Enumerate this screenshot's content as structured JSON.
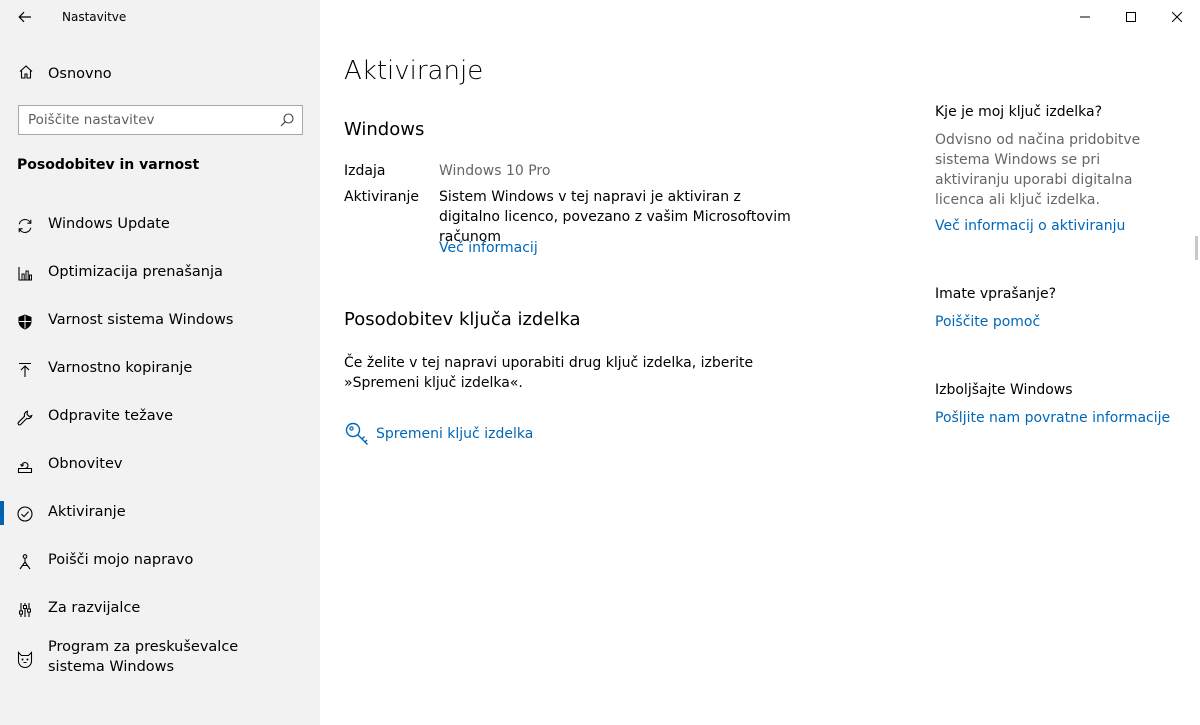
{
  "window": {
    "title": "Nastavitve"
  },
  "sidebar": {
    "home_label": "Osnovno",
    "search_placeholder": "Poiščite nastavitev",
    "section_title": "Posodobitev in varnost",
    "items": [
      {
        "label": "Windows Update",
        "icon": "refresh-icon"
      },
      {
        "label": "Optimizacija prenašanja",
        "icon": "delivery-optimization-icon"
      },
      {
        "label": "Varnost sistema Windows",
        "icon": "shield-icon"
      },
      {
        "label": "Varnostno kopiranje",
        "icon": "backup-upload-icon"
      },
      {
        "label": "Odpravite težave",
        "icon": "wrench-icon"
      },
      {
        "label": "Obnovitev",
        "icon": "recovery-icon"
      },
      {
        "label": "Aktiviranje",
        "icon": "check-circle-icon",
        "active": true
      },
      {
        "label": "Poišči mojo napravo",
        "icon": "find-device-icon"
      },
      {
        "label": "Za razvijalce",
        "icon": "developer-sliders-icon"
      },
      {
        "label": "Program za preskuševalce sistema Windows",
        "icon": "insider-cat-icon"
      }
    ]
  },
  "main": {
    "title": "Aktiviranje",
    "windows_section": {
      "heading": "Windows",
      "edition_label": "Izdaja",
      "edition_value": "Windows 10 Pro",
      "activation_label": "Aktiviranje",
      "activation_value": "Sistem Windows v tej napravi je aktiviran z digitalno licenco, povezano z vašim Microsoftovim računom",
      "more_info_link": "Več informacij"
    },
    "key_section": {
      "heading": "Posodobitev ključa izdelka",
      "description": "Če želite v tej napravi uporabiti drug ključ izdelka, izberite »Spremeni ključ izdelka«.",
      "change_key_label": "Spremeni ključ izdelka"
    }
  },
  "aside": {
    "q1_heading": "Kje je moj ključ izdelka?",
    "q1_text": "Odvisno od načina pridobitve sistema Windows se pri aktiviranju uporabi digitalna licenca ali ključ izdelka.",
    "q1_link": "Več informacij o aktiviranju",
    "q2_heading": "Imate vprašanje?",
    "q2_link": "Poiščite pomoč",
    "q3_heading": "Izboljšajte Windows",
    "q3_link": "Pošljite nam povratne informacije"
  },
  "colors": {
    "accent": "#0067b8",
    "sidebar_bg": "#f2f2f2",
    "muted_text": "#666666"
  }
}
